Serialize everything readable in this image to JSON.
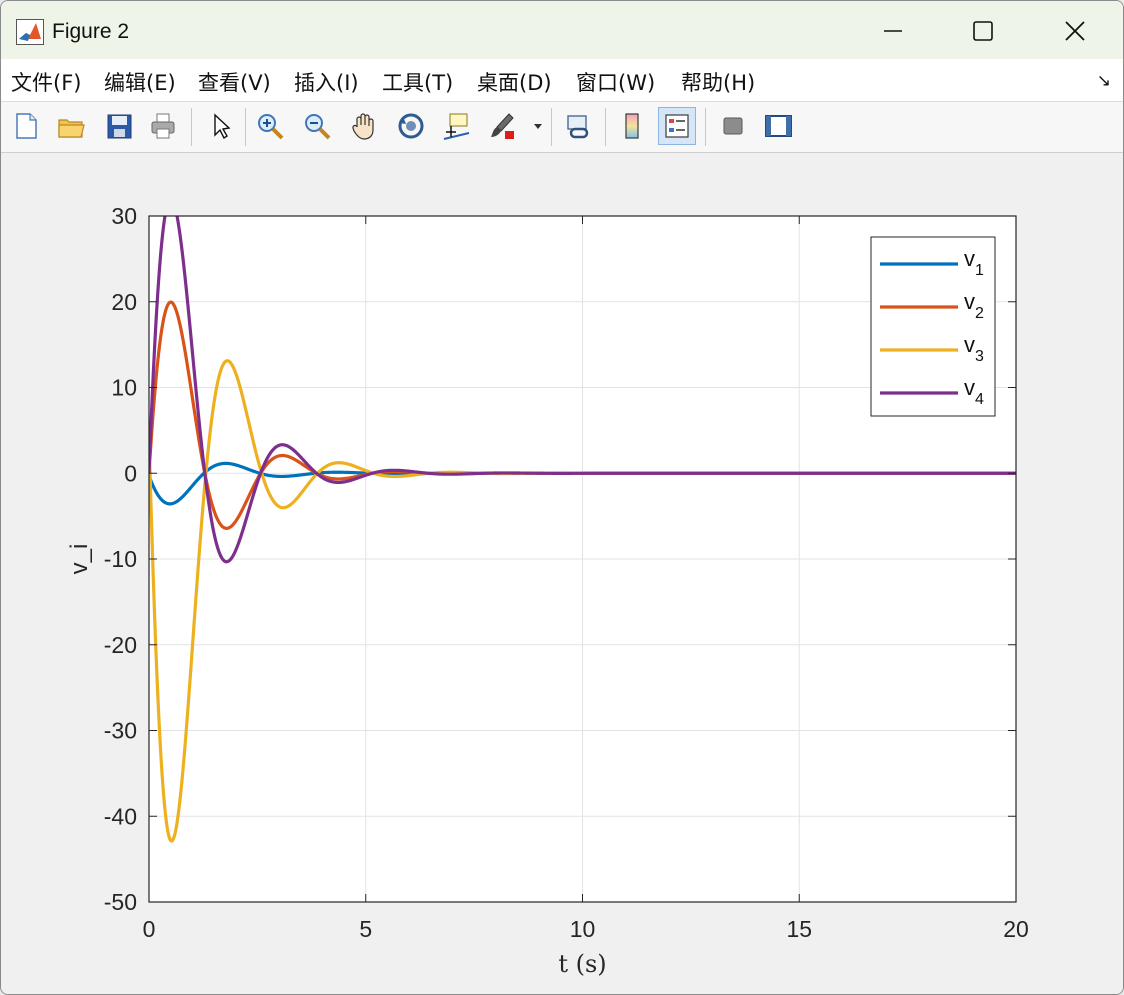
{
  "window": {
    "title": "Figure 2",
    "minimize_icon": "minimize-icon",
    "maximize_icon": "maximize-icon",
    "close_icon": "close-icon"
  },
  "menu": {
    "items": [
      {
        "label": "文件(F)",
        "key": "F"
      },
      {
        "label": "编辑(E)",
        "key": "E"
      },
      {
        "label": "查看(V)",
        "key": "V"
      },
      {
        "label": "插入(I)",
        "key": "I"
      },
      {
        "label": "工具(T)",
        "key": "T"
      },
      {
        "label": "桌面(D)",
        "key": "D"
      },
      {
        "label": "窗口(W)",
        "key": "W"
      },
      {
        "label": "帮助(H)",
        "key": "H"
      }
    ],
    "dock_icon": "dock-figure-icon"
  },
  "toolbar": {
    "buttons": [
      {
        "icon": "new-figure-icon"
      },
      {
        "icon": "open-file-icon"
      },
      {
        "icon": "save-icon"
      },
      {
        "icon": "print-icon"
      },
      {
        "icon": "edit-plot-arrow-icon"
      },
      {
        "icon": "zoom-in-icon"
      },
      {
        "icon": "zoom-out-icon"
      },
      {
        "icon": "pan-hand-icon"
      },
      {
        "icon": "rotate-3d-icon"
      },
      {
        "icon": "data-cursor-icon"
      },
      {
        "icon": "brush-icon"
      },
      {
        "icon": "link-plot-icon"
      },
      {
        "icon": "colorbar-icon"
      },
      {
        "icon": "legend-icon",
        "active": true
      },
      {
        "icon": "hide-plot-tools-icon"
      },
      {
        "icon": "show-plot-tools-icon"
      }
    ]
  },
  "chart_data": {
    "type": "line",
    "title": "",
    "xlabel": "t (s)",
    "ylabel": "v_i",
    "xlim": [
      0,
      20
    ],
    "ylim": [
      -50,
      30
    ],
    "xticks": [
      0,
      5,
      10,
      15,
      20
    ],
    "yticks": [
      -50,
      -40,
      -30,
      -20,
      -10,
      0,
      10,
      20,
      30
    ],
    "grid": true,
    "legend_position": "top-right",
    "line_model": "damped oscillation: y(t) = A * exp(-d*t) * sin(w*t + phi)",
    "series": [
      {
        "name": "v1",
        "legend_base": "v",
        "legend_sub": "1",
        "color": "#0072BD",
        "A": -5.8,
        "d": 0.88,
        "w": 2.44,
        "phi": 0.05,
        "x": [
          0,
          0.65,
          1.9,
          3.2,
          4.5,
          5.8,
          7.1,
          10,
          20
        ],
        "y": [
          -0.3,
          -3.6,
          2.7,
          -1.1,
          0.7,
          -0.3,
          0.15,
          0,
          0
        ]
      },
      {
        "name": "v2",
        "legend_base": "v",
        "legend_sub": "2",
        "color": "#D95319",
        "A": 33,
        "d": 0.88,
        "w": 2.44,
        "phi": 0,
        "x": [
          0,
          0.6,
          1.85,
          3.15,
          4.45,
          5.8,
          7.1,
          10,
          20
        ],
        "y": [
          0,
          18.7,
          -12,
          7.9,
          -4,
          1.9,
          -0.9,
          0,
          0
        ]
      },
      {
        "name": "v3",
        "legend_base": "v",
        "legend_sub": "3",
        "color": "#EDB120",
        "A": -74,
        "d": 0.92,
        "w": 2.44,
        "phi": -0.06,
        "x": [
          0,
          0.6,
          1.9,
          3.2,
          4.5,
          5.8,
          7.1,
          10,
          20
        ],
        "y": [
          4,
          -40.5,
          21.7,
          -11,
          5.9,
          -3,
          1.5,
          0.3,
          0
        ]
      },
      {
        "name": "v4",
        "legend_base": "v",
        "legend_sub": "4",
        "color": "#7E2F8E",
        "A": 53,
        "d": 0.88,
        "w": 2.44,
        "phi": 0,
        "x": [
          0,
          0.62,
          1.95,
          3.25,
          4.55,
          5.85,
          7.15,
          10,
          20
        ],
        "y": [
          0,
          29.3,
          -11.6,
          4.8,
          -2.4,
          1.7,
          -1.1,
          0,
          0
        ]
      }
    ]
  }
}
